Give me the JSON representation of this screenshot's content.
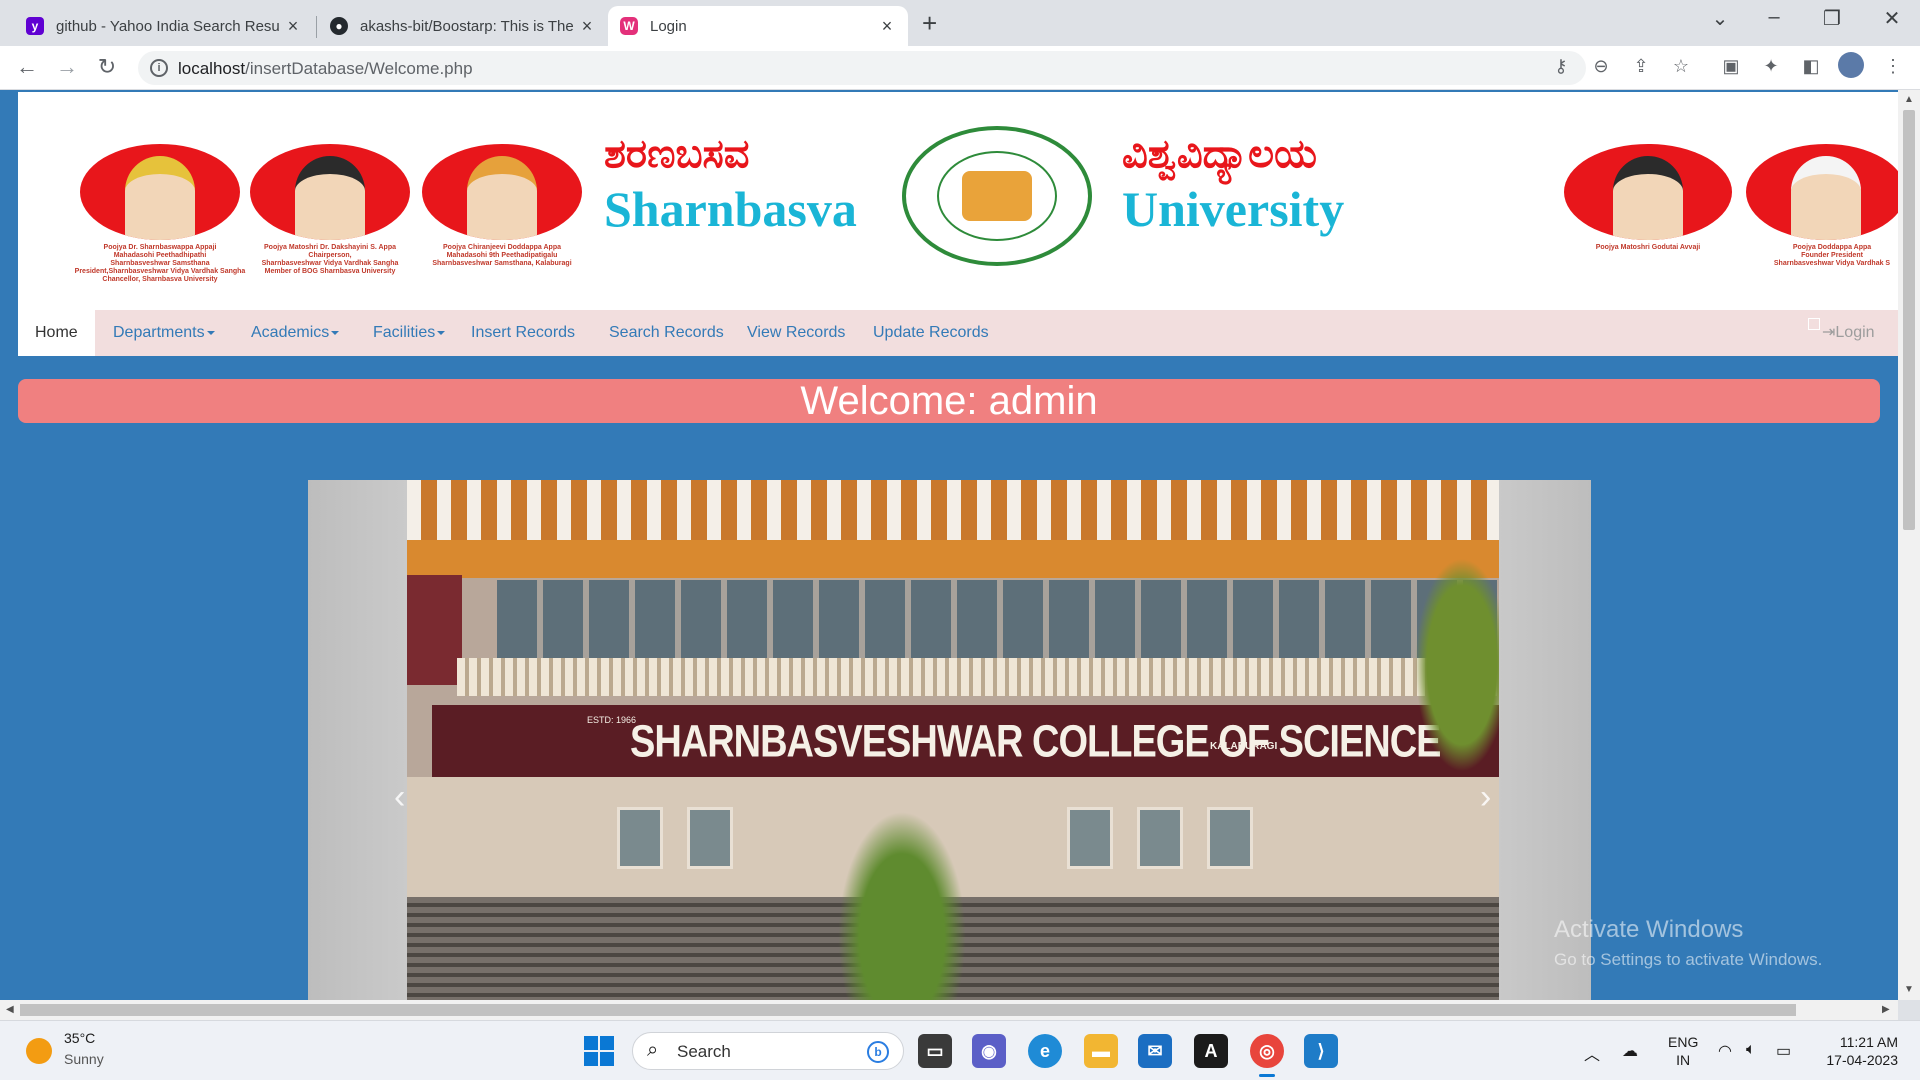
{
  "browser": {
    "tabs": [
      {
        "title": "github - Yahoo India Search Resu",
        "icon": "yahoo-icon",
        "active": false
      },
      {
        "title": "akashs-bit/Boostarp: This is The C",
        "icon": "github-icon",
        "active": false
      },
      {
        "title": "Login",
        "icon": "site-icon",
        "active": true
      }
    ],
    "url_host": "localhost",
    "url_path": "/insertDatabase/Welcome.php"
  },
  "site": {
    "banner": {
      "kannada_left": "ಶರಣಬಸವ",
      "kannada_right": "ವಿಶ್ವವಿದ್ಯಾಲಯ",
      "english_left": "Sharnbasva",
      "english_right": "University",
      "portraits": [
        {
          "caption": "Poojya Dr. Sharnbaswappa Appaji\nMahadasohi Peethadhipathi\nSharnbasveshwar Samsthana\nPresident,Sharnbasveshwar Vidya Vardhak Sangha\nChancellor, Sharnbasva University"
        },
        {
          "caption": "Poojya Matoshri Dr. Dakshayini S. Appa\nChairperson,\nSharnbasveshwar Vidya Vardhak Sangha\nMember of BOG Sharnbasva University"
        },
        {
          "caption": "Poojya Chiranjeevi Doddappa Appa\nMahadasohi 9th Peethadipatigalu\nSharnbasveshwar Samsthana, Kalaburagi"
        },
        {
          "caption": "Poojya Matoshri Godutai Avvaji"
        },
        {
          "caption": "Poojya Doddappa Appa\nFounder President\nSharnbasveshwar Vidya Vardhak S"
        }
      ]
    },
    "nav": {
      "items": [
        {
          "label": "Home",
          "dropdown": false
        },
        {
          "label": "Departments",
          "dropdown": true
        },
        {
          "label": "Academics",
          "dropdown": true
        },
        {
          "label": "Facilities",
          "dropdown": true
        },
        {
          "label": "Insert Records",
          "dropdown": false
        },
        {
          "label": "Search Records",
          "dropdown": false
        },
        {
          "label": "View Records",
          "dropdown": false
        },
        {
          "label": "Update Records",
          "dropdown": false
        }
      ],
      "login": "Login"
    },
    "welcome": "Welcome: admin",
    "carousel": {
      "sign_text": "SHARNBASVESHWAR COLLEGE OF SCIENCE",
      "sign_small": "ESTD: 1966",
      "sign_city": "KALABURAGI",
      "prev": "‹",
      "next": "›"
    }
  },
  "watermark": {
    "line1": "Activate Windows",
    "line2": "Go to Settings to activate Windows."
  },
  "taskbar": {
    "weather_temp": "35°C",
    "weather_cond": "Sunny",
    "search_label": "Search",
    "lang_top": "ENG",
    "lang_bottom": "IN",
    "time": "11:21 AM",
    "date": "17-04-2023"
  },
  "colors": {
    "page_bg": "#337ab7",
    "nav_bg": "#f2dede",
    "welcome_bg": "#f08080",
    "banner_red": "#e8161b",
    "banner_cyan": "#1ab5d6"
  }
}
